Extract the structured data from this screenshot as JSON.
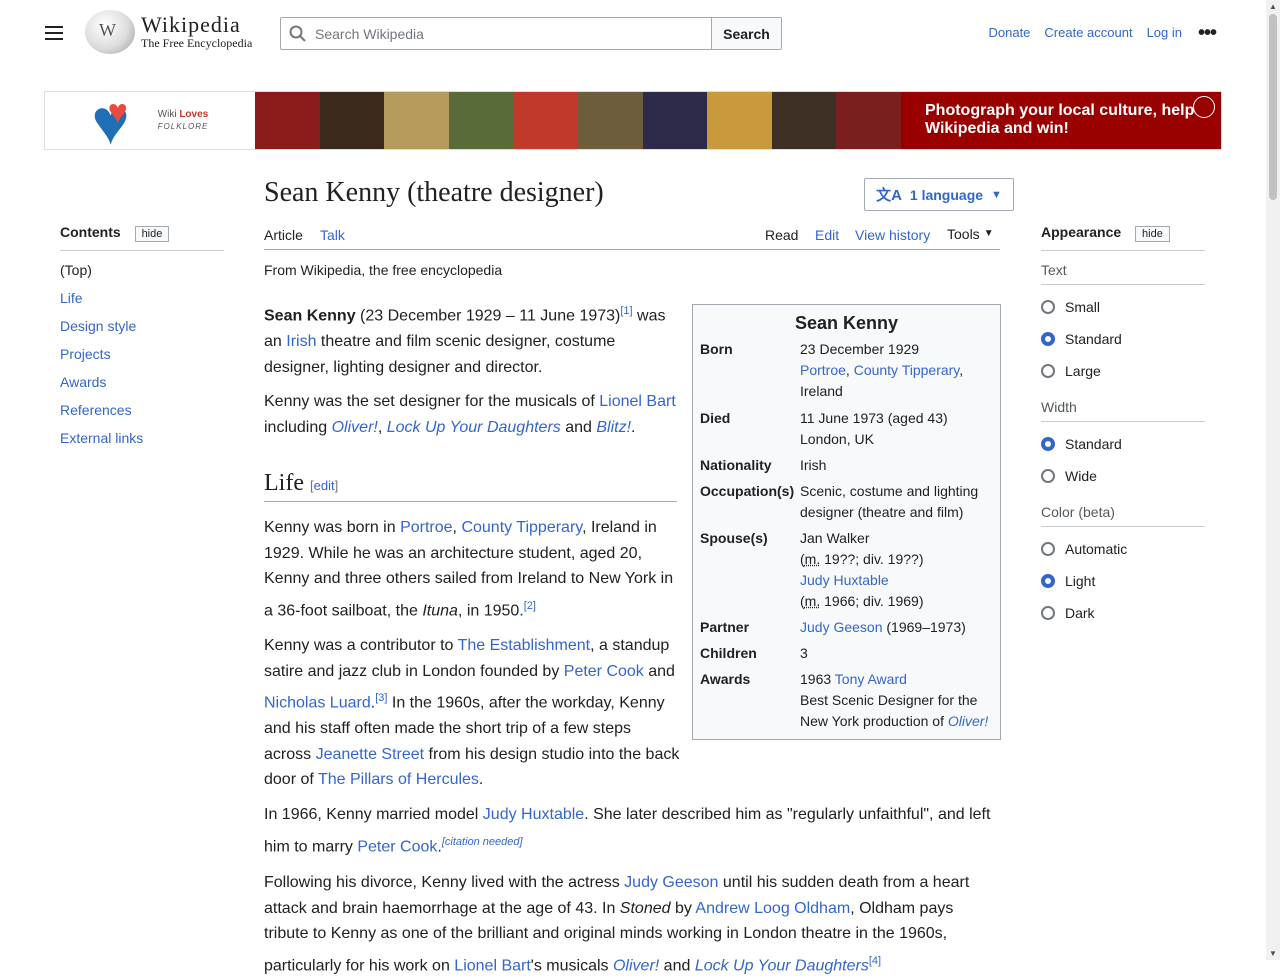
{
  "header": {
    "menu_icon": "hamburger-menu-icon",
    "logo_wordmark": "Wikipedia",
    "logo_tagline": "The Free Encyclopedia",
    "search_placeholder": "Search Wikipedia",
    "search_button": "Search",
    "donate": "Donate",
    "create_account": "Create account",
    "log_in": "Log in",
    "more_icon": "ellipsis-icon",
    "more_label": "•••"
  },
  "banner": {
    "logo_line1": "Wiki",
    "logo_line1b": "Loves",
    "logo_line2": "FOLKLORE",
    "cta": "Photograph your local culture, help Wikipedia and win!",
    "photo_colors": [
      "#8b1a1a",
      "#3a2a1e",
      "#b59a5b",
      "#5a6b3a",
      "#c0392b",
      "#6d5d3d",
      "#2d2a4a",
      "#c89a3d",
      "#3e2f24",
      "#7a1e1e"
    ]
  },
  "toc": {
    "title": "Contents",
    "hide": "hide",
    "items": [
      "(Top)",
      "Life",
      "Design style",
      "Projects",
      "Awards",
      "References",
      "External links"
    ]
  },
  "article": {
    "title": "Sean Kenny (theatre designer)",
    "language_button": "1 language",
    "tabs": {
      "article": "Article",
      "talk": "Talk",
      "read": "Read",
      "edit": "Edit",
      "history": "View history",
      "tools": "Tools"
    },
    "from": "From Wikipedia, the free encyclopedia",
    "p1_name": "Sean Kenny",
    "p1_a": " (23 December 1929 – 11 June 1973)",
    "p1_ref": "[1]",
    "p1_b": " was an ",
    "p1_link": "Irish",
    "p1_c": " theatre and film scenic designer, costume designer, lighting designer and director.",
    "p2_a": "Kenny was the set designer for the musicals of ",
    "p2_link1": "Lionel Bart",
    "p2_b": " including ",
    "p2_link2": "Oliver!",
    "p2_c": ", ",
    "p2_link3": "Lock Up Your Daughters",
    "p2_d": " and ",
    "p2_link4": "Blitz!",
    "p2_e": ".",
    "h_life": "Life",
    "h_edit": "edit",
    "p3_a": "Kenny was born in ",
    "p3_link1": "Portroe",
    "p3_b": ", ",
    "p3_link2": "County Tipperary",
    "p3_c": ", Ireland in 1929. While he was an architecture student, aged 20, Kenny and three others sailed from Ireland to New York in a 36-foot sailboat, the ",
    "p3_ship": "Ituna",
    "p3_d": ", in 1950.",
    "p3_ref": "[2]",
    "p4_a": "Kenny was a contributor to ",
    "p4_link1": "The Establishment",
    "p4_b": ", a standup satire and jazz club in London founded by ",
    "p4_link2": "Peter Cook",
    "p4_c": " and ",
    "p4_link3": "Nicholas Luard",
    "p4_d": ".",
    "p4_ref": "[3]",
    "p4_e": " In the 1960s, after the workday, Kenny and his staff often made the short trip of a few steps across ",
    "p4_link4": "Jeanette Street",
    "p4_f": " from his design studio into the back door of ",
    "p4_link5": "The Pillars of Hercules",
    "p4_g": ".",
    "p5_a": "In 1966, Kenny married model ",
    "p5_link1": "Judy Huxtable",
    "p5_b": ". She later described him as \"regularly unfaithful\", and left him to marry ",
    "p5_link2": "Peter Cook",
    "p5_c": ".",
    "p5_cite": "[citation needed]",
    "p6_a": "Following his divorce, Kenny lived with the actress ",
    "p6_link1": "Judy Geeson",
    "p6_b": " until his sudden death from a heart attack and brain haemorrhage at the age of 43. In ",
    "p6_book": "Stoned",
    "p6_c": " by ",
    "p6_link2": "Andrew Loog Oldham",
    "p6_d": ", Oldham pays tribute to Kenny as one of the brilliant and original minds working in London theatre in the 1960s, particularly for his work on ",
    "p6_link3": "Lionel Bart",
    "p6_e": "'s musicals ",
    "p6_link4": "Oliver!",
    "p6_f": " and ",
    "p6_link5": "Lock Up Your Daughters",
    "p6_ref": "[4]"
  },
  "infobox": {
    "title": "Sean Kenny",
    "born_label": "Born",
    "born_date": "23 December 1929",
    "born_place1": "Portroe",
    "born_place2": "County Tipperary",
    "born_place3": "Ireland",
    "died_label": "Died",
    "died_date": "11 June 1973 (aged 43)",
    "died_place": "London, UK",
    "nationality_label": "Nationality",
    "nationality": "Irish",
    "occupation_label": "Occupation(s)",
    "occupation": "Scenic, costume and lighting designer (theatre and film)",
    "spouses_label": "Spouse(s)",
    "spouse1": "Jan Walker",
    "spouse1_years": "19??; div. 19??",
    "spouse2": "Judy Huxtable",
    "spouse2_years": "1966; div. 1969",
    "m_abbr": "m.",
    "partner_label": "Partner",
    "partner": "Judy Geeson",
    "partner_years": " (1969–1973)",
    "children_label": "Children",
    "children": "3",
    "awards_label": "Awards",
    "award_year": "1963 ",
    "award": "Tony Award",
    "award_desc": "Best Scenic Designer for the New York production of ",
    "award_show": "Oliver!"
  },
  "appearance": {
    "title": "Appearance",
    "hide": "hide",
    "text_label": "Text",
    "text_options": [
      "Small",
      "Standard",
      "Large"
    ],
    "text_selected": 1,
    "width_label": "Width",
    "width_options": [
      "Standard",
      "Wide"
    ],
    "width_selected": 0,
    "color_label": "Color (beta)",
    "color_options": [
      "Automatic",
      "Light",
      "Dark"
    ],
    "color_selected": 1
  }
}
